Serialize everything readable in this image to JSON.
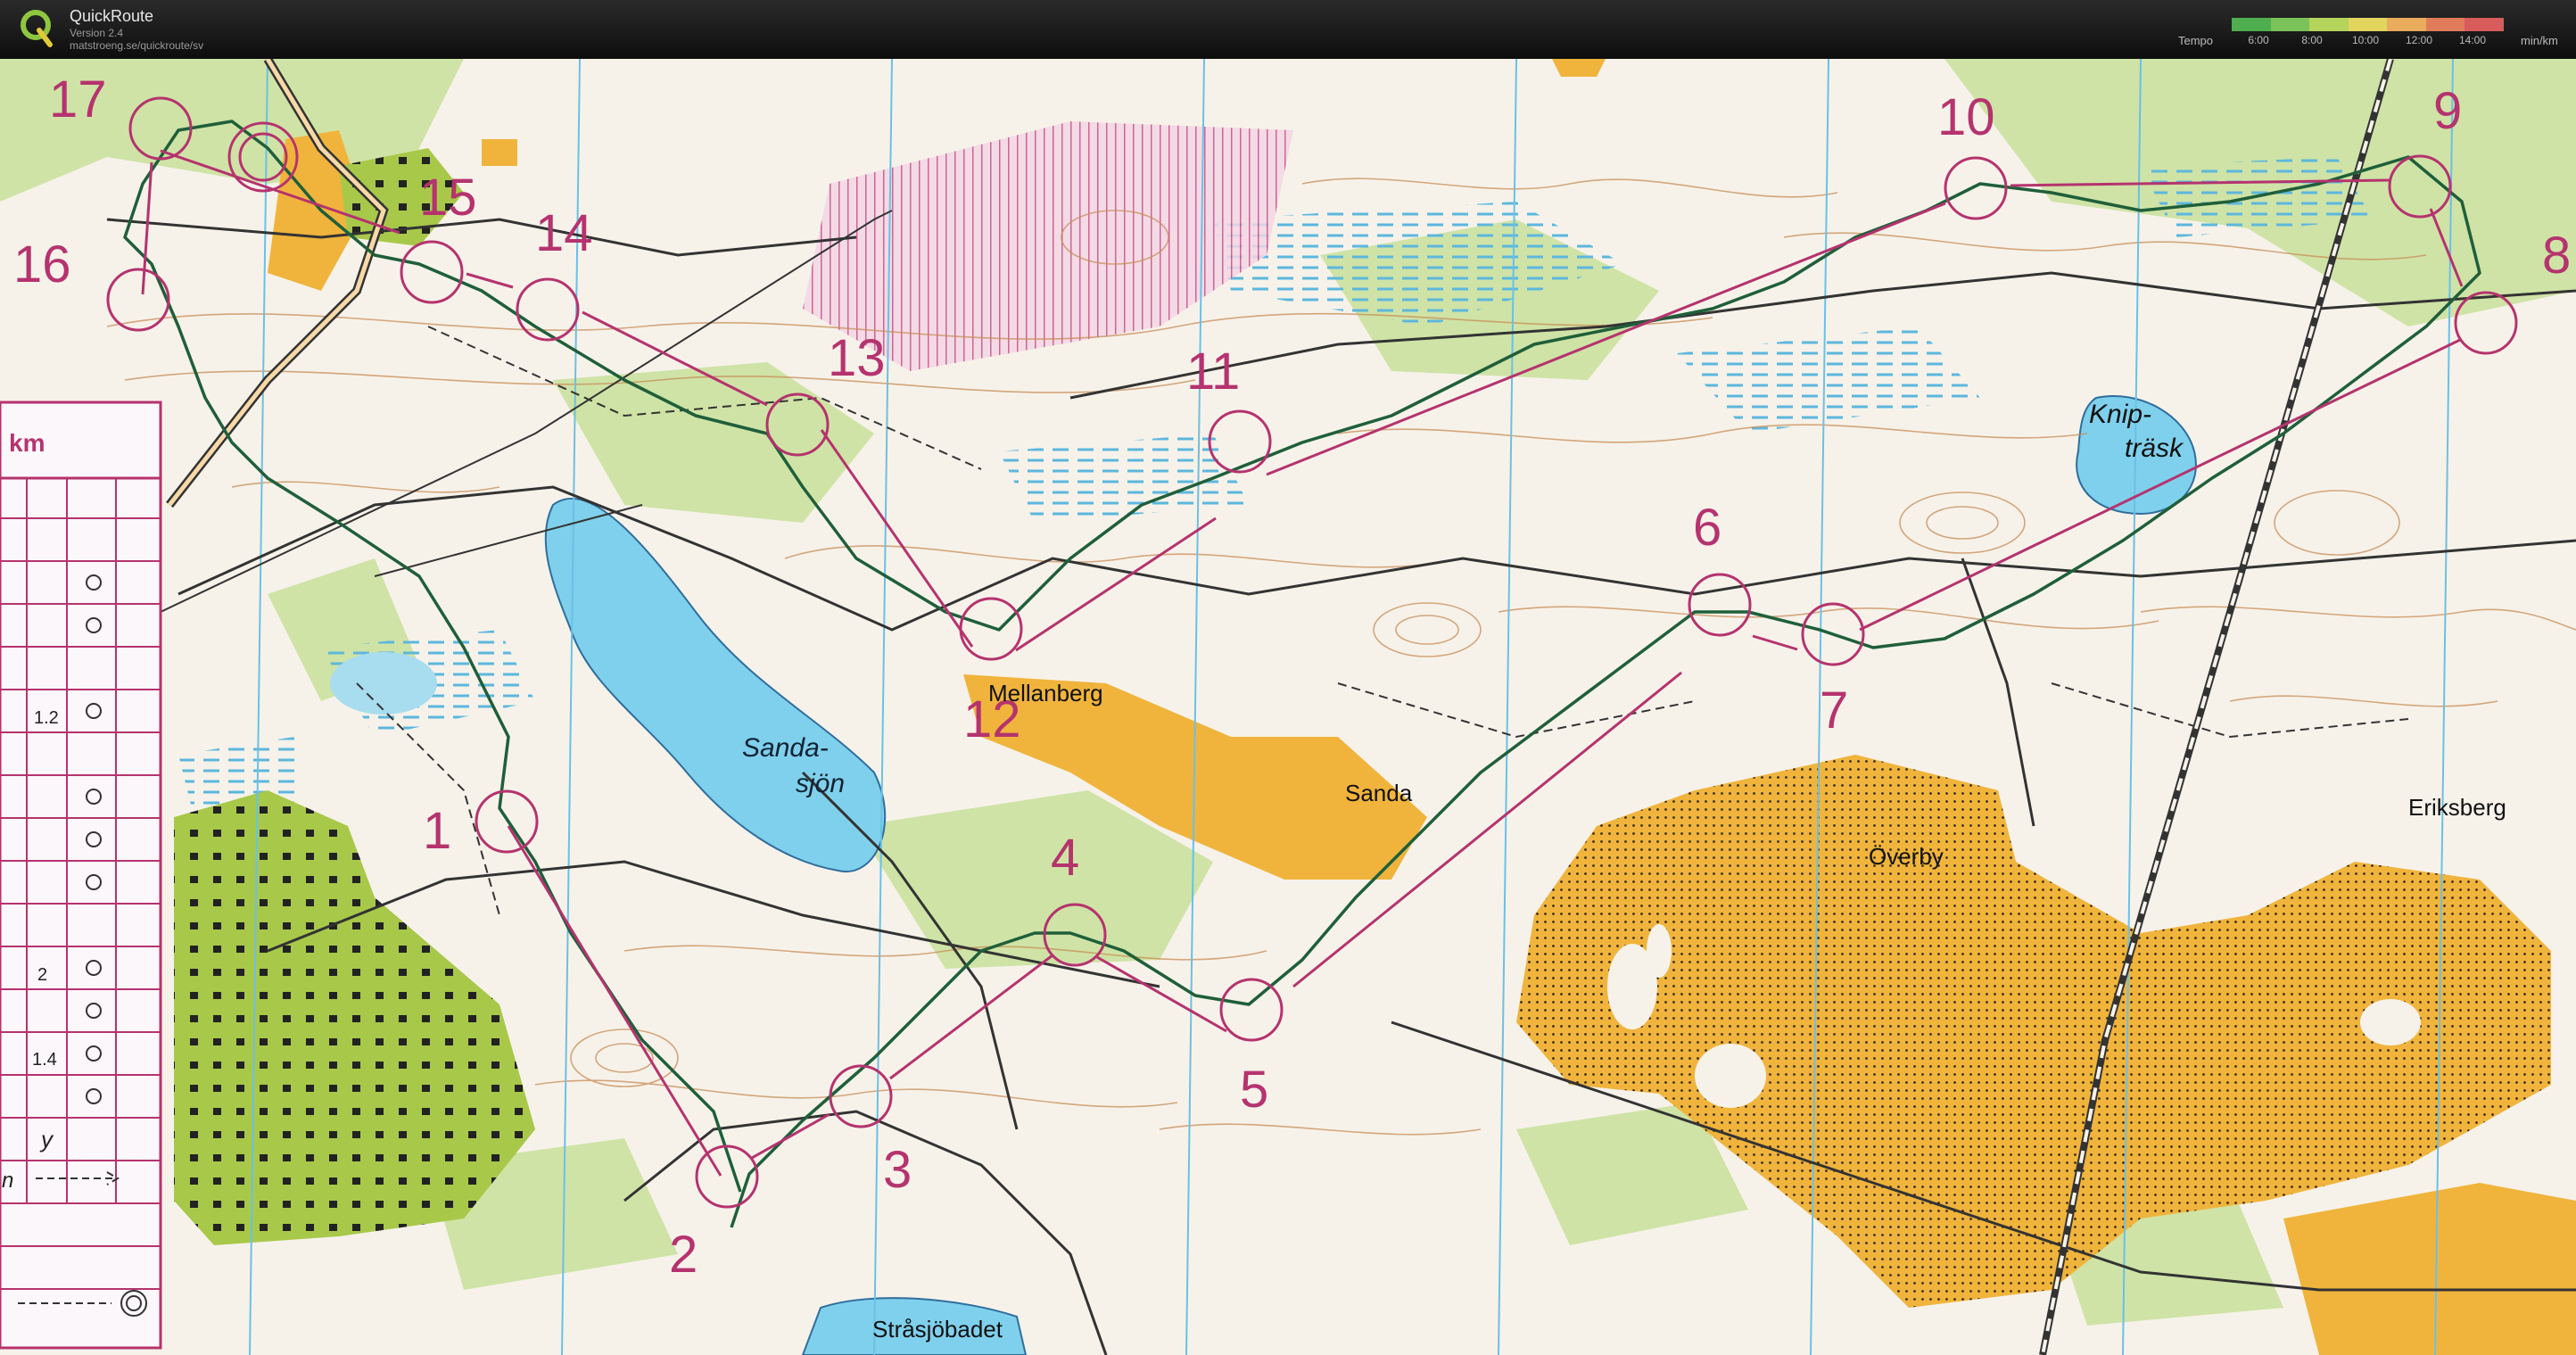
{
  "app": {
    "title": "QuickRoute",
    "version": "Version 2.4",
    "url": "matstroeng.se/quickroute/sv",
    "logo_letter": "Q"
  },
  "tempo": {
    "label": "Tempo",
    "unit": "min/km",
    "ticks": [
      "6:00",
      "8:00",
      "10:00",
      "12:00",
      "14:00"
    ],
    "gradient_colors": [
      "#4fae4f",
      "#7cc25a",
      "#b4d45c",
      "#e2d55e",
      "#e9ab5c",
      "#e07c5a",
      "#d85c5c"
    ]
  },
  "map": {
    "colors": {
      "paper": "#f6f2ea",
      "forest": "#cfe3a6",
      "lake": "#7fd0ec",
      "field": "#f0b43c",
      "purple": "#b5336e",
      "route": "#1f5f3a",
      "road": "#333333",
      "contour": "#c88c55"
    },
    "controls": [
      "1",
      "2",
      "3",
      "4",
      "5",
      "6",
      "7",
      "8",
      "9",
      "10",
      "11",
      "12",
      "13",
      "14",
      "15",
      "16",
      "17"
    ],
    "place_names": {
      "sandasjon_1": "Sanda-",
      "sandasjon_2": "sjön",
      "mellanberg": "Mellanberg",
      "sanda": "Sanda",
      "overby": "Överby",
      "eriksberg": "Eriksberg",
      "knip_1": "Knip-",
      "knip_2": "träsk",
      "stralsjobadet": "Stråsjöbadet"
    },
    "legend": {
      "header": "km",
      "distances": [
        "1.2",
        "2",
        "1.4"
      ],
      "footer_1": "y",
      "footer_2": "n"
    }
  }
}
